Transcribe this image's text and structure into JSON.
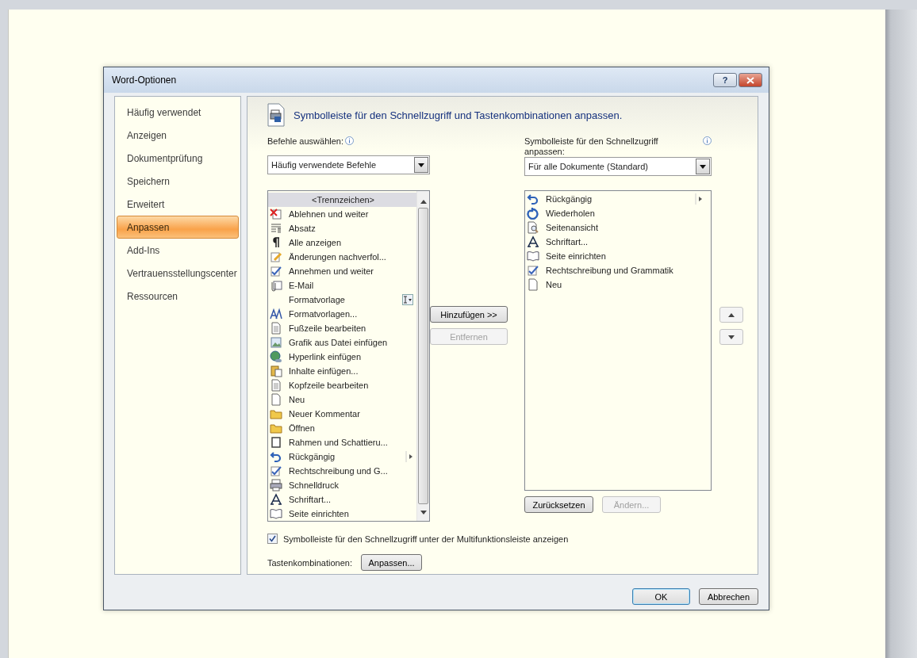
{
  "window": {
    "title": "Word-Optionen",
    "buttons": [
      "?"
    ]
  },
  "sidebar": {
    "items": [
      {
        "label": "Häufig verwendet",
        "selected": false
      },
      {
        "label": "Anzeigen",
        "selected": false
      },
      {
        "label": "Dokumentprüfung",
        "selected": false
      },
      {
        "label": "Speichern",
        "selected": false
      },
      {
        "label": "Erweitert",
        "selected": false
      },
      {
        "label": "Anpassen",
        "selected": true
      },
      {
        "label": "Add-Ins",
        "selected": false
      },
      {
        "label": "Vertrauensstellungscenter",
        "selected": false
      },
      {
        "label": "Ressourcen",
        "selected": false
      }
    ]
  },
  "header": {
    "title": "Symbolleiste für den Schnellzugriff und Tastenkombinationen anpassen."
  },
  "commands": {
    "label": "Befehle auswählen:",
    "dropdown": "Häufig verwendete Befehle",
    "items": [
      {
        "label": "<Trennzeichen>",
        "kind": "separator",
        "selected": true
      },
      {
        "label": "Ablehnen und weiter",
        "kind": "command",
        "selected": false
      },
      {
        "label": "Absatz",
        "kind": "command",
        "selected": false
      },
      {
        "label": "Alle anzeigen",
        "kind": "command",
        "selected": false
      },
      {
        "label": "Änderungen nachverfol...",
        "kind": "command",
        "selected": false
      },
      {
        "label": "Annehmen und weiter",
        "kind": "command",
        "selected": false
      },
      {
        "label": "E-Mail",
        "kind": "command",
        "selected": false
      },
      {
        "label": "Formatvorlage",
        "kind": "dropdown",
        "selected": false
      },
      {
        "label": "Formatvorlagen...",
        "kind": "command",
        "selected": false
      },
      {
        "label": "Fußzeile bearbeiten",
        "kind": "command",
        "selected": false
      },
      {
        "label": "Grafik aus Datei einfügen",
        "kind": "command",
        "selected": false
      },
      {
        "label": "Hyperlink einfügen",
        "kind": "command",
        "selected": false
      },
      {
        "label": "Inhalte einfügen...",
        "kind": "command",
        "selected": false
      },
      {
        "label": "Kopfzeile bearbeiten",
        "kind": "command",
        "selected": false
      },
      {
        "label": "Neu",
        "kind": "command",
        "selected": false
      },
      {
        "label": "Neuer Kommentar",
        "kind": "command",
        "selected": false
      },
      {
        "label": "Öffnen",
        "kind": "command",
        "selected": false
      },
      {
        "label": "Rahmen und Schattieru...",
        "kind": "command",
        "selected": false
      },
      {
        "label": "Rückgängig",
        "kind": "submenu",
        "selected": false
      },
      {
        "label": "Rechtschreibung und G...",
        "kind": "command",
        "selected": false
      },
      {
        "label": "Schnelldruck",
        "kind": "command",
        "selected": false
      },
      {
        "label": "Schriftart...",
        "kind": "command",
        "selected": false
      },
      {
        "label": "Seite einrichten",
        "kind": "command",
        "selected": false
      }
    ]
  },
  "add_button": {
    "label": "Hinzufügen >>",
    "disabled": false
  },
  "remove_button": {
    "label": "Entfernen",
    "disabled": true
  },
  "toolbar": {
    "label": "Symbolleiste für den Schnellzugriff anpassen:",
    "dropdown": "Für alle Dokumente (Standard)",
    "items": [
      {
        "label": "Rückgängig",
        "kind": "submenu",
        "selected": false
      },
      {
        "label": "Wiederholen",
        "kind": "command",
        "selected": false
      },
      {
        "label": "Seitenansicht",
        "kind": "command",
        "selected": false
      },
      {
        "label": "Schriftart...",
        "kind": "command",
        "selected": false
      },
      {
        "label": "Seite einrichten",
        "kind": "command",
        "selected": false
      },
      {
        "label": "Rechtschreibung und Grammatik",
        "kind": "command",
        "selected": false
      },
      {
        "label": "Neu",
        "kind": "command",
        "selected": false
      }
    ]
  },
  "reset_button": {
    "label": "Zurücksetzen",
    "disabled": false
  },
  "modify_button": {
    "label": "Ändern...",
    "disabled": true
  },
  "show_below_ribbon": {
    "label": "Symbolleiste für den Schnellzugriff unter der Multifunktionsleiste anzeigen",
    "checked": true
  },
  "shortcuts": {
    "label": "Tastenkombinationen:",
    "button": "Anpassen..."
  },
  "footer": {
    "buttons": [
      "OK",
      "Abbrechen"
    ]
  }
}
